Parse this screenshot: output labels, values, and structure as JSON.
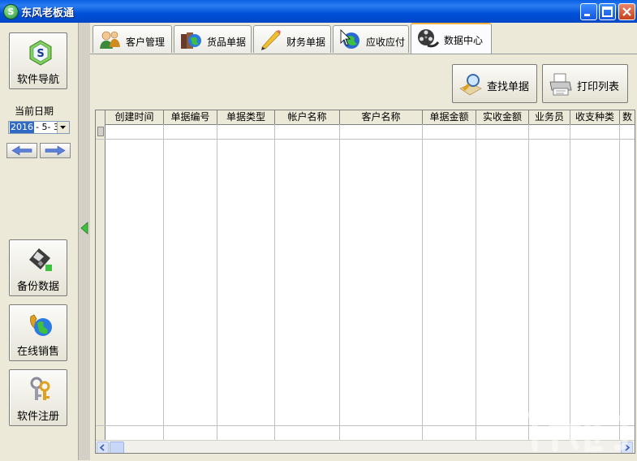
{
  "window": {
    "title": "东风老板通"
  },
  "sidebar": {
    "nav_label": "软件导航",
    "date_label": "当前日期",
    "date_year": "2016",
    "date_rest": "- 5- 3",
    "backup_label": "备份数据",
    "online_label": "在线销售",
    "register_label": "软件注册"
  },
  "tabs": [
    {
      "label": "客户管理"
    },
    {
      "label": "货品单据"
    },
    {
      "label": "财务单据"
    },
    {
      "label": "应收应付"
    },
    {
      "label": "数据中心"
    }
  ],
  "toolbar": {
    "find_label": "查找单据",
    "print_label": "打印列表"
  },
  "grid": {
    "columns": [
      "创建时间",
      "单据编号",
      "单据类型",
      "帐户名称",
      "客户名称",
      "单据金额",
      "实收金额",
      "业务员",
      "收支种类",
      "数"
    ]
  },
  "colors": {
    "title_bar": "#0a5fe4",
    "active_tab_accent": "#f3b33d",
    "selection": "#316ac5"
  }
}
